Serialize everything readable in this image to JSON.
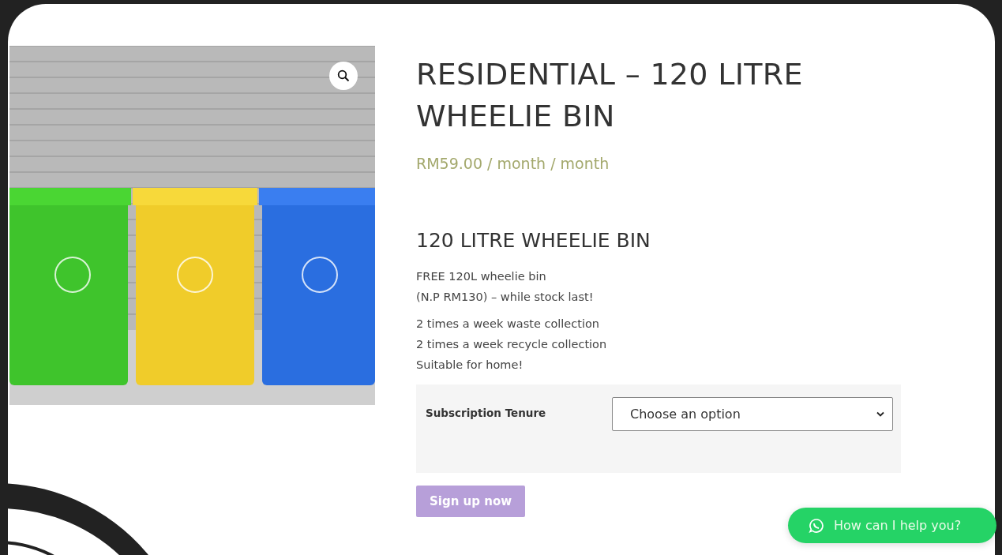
{
  "product": {
    "title": "RESIDENTIAL – 120 LITRE WHEELIE BIN",
    "price": "RM59.00 / month / month"
  },
  "description": {
    "heading": "120 LITRE WHEELIE BIN",
    "paragraphs": [
      [
        "FREE 120L wheelie bin",
        "(N.P RM130) – while stock last!"
      ],
      [
        "2 times a week waste collection",
        "2 times a week recycle collection",
        "Suitable for home!"
      ]
    ]
  },
  "variations": [
    {
      "label": "Subscription Tenure",
      "value": "Choose an option"
    }
  ],
  "signup_button": {
    "label": "Sign up now",
    "disabled": true
  },
  "chat_button": {
    "label": "How can I help you?"
  }
}
